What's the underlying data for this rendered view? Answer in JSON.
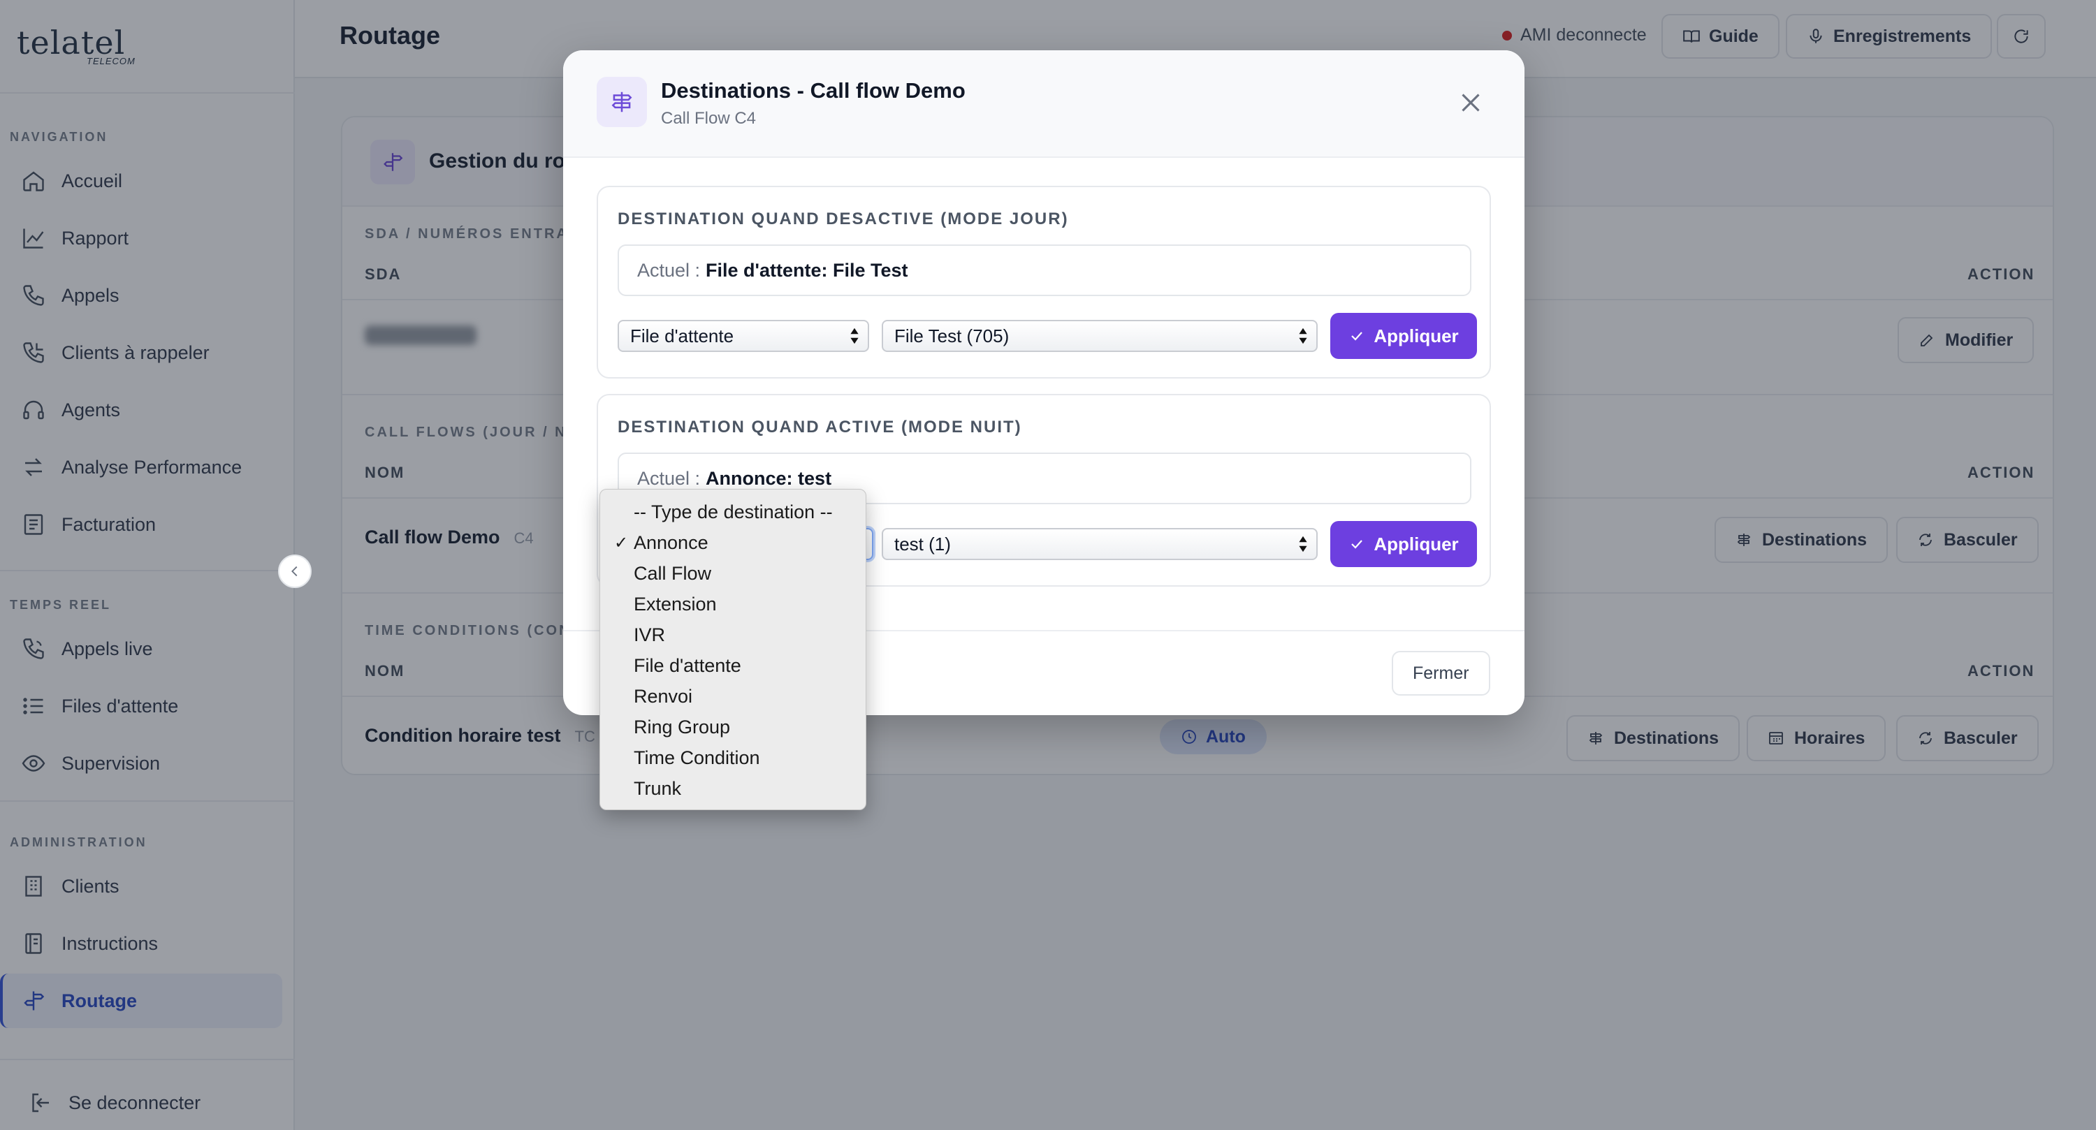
{
  "sidebar": {
    "logo_text": "telatel",
    "logo_sub": "TELECOM",
    "sections": {
      "navigation": "NAVIGATION",
      "realtime": "TEMPS REEL",
      "admin": "ADMINISTRATION"
    },
    "items": [
      {
        "label": "Accueil",
        "icon": "home-icon"
      },
      {
        "label": "Rapport",
        "icon": "chart-icon"
      },
      {
        "label": "Appels",
        "icon": "phone-icon"
      },
      {
        "label": "Clients à rappeler",
        "icon": "phone-callback-icon"
      },
      {
        "label": "Agents",
        "icon": "headset-icon"
      },
      {
        "label": "Analyse Performance",
        "icon": "arrows-icon"
      },
      {
        "label": "Facturation",
        "icon": "receipt-icon"
      },
      {
        "label": "Appels live",
        "icon": "phone-live-icon"
      },
      {
        "label": "Files d'attente",
        "icon": "list-icon"
      },
      {
        "label": "Supervision",
        "icon": "eye-icon"
      },
      {
        "label": "Clients",
        "icon": "building-icon"
      },
      {
        "label": "Instructions",
        "icon": "book-icon"
      },
      {
        "label": "Routage",
        "icon": "signpost-icon"
      }
    ],
    "logout": "Se deconnecter"
  },
  "topbar": {
    "title": "Routage",
    "ami_status": "AMI deconnecte",
    "guide": "Guide",
    "recordings": "Enregistrements"
  },
  "card": {
    "title": "Gestion du rou",
    "sda_section": "SDA / NUMÉROS ENTRAN",
    "sda_col": "SDA",
    "action_col": "ACTION",
    "modify": "Modifier",
    "cf_section": "CALL FLOWS (JOUR / NU",
    "name_col": "NOM",
    "cf_row_name": "Call flow Demo",
    "cf_row_code": "C4",
    "destinations": "Destinations",
    "toggle": "Basculer",
    "tc_section": "TIME CONDITIONS (CON",
    "tc_row_name": "Condition horaire test",
    "tc_row_code": "TC",
    "auto": "Auto",
    "schedules": "Horaires"
  },
  "modal": {
    "title": "Destinations - Call flow Demo",
    "subtitle": "Call Flow C4",
    "day": {
      "heading": "DESTINATION QUAND DESACTIVE (MODE JOUR)",
      "current_prefix": "Actuel :",
      "current_value": "File d'attente: File Test",
      "type_value": "File d'attente",
      "target_value": "File Test (705)",
      "apply": "Appliquer"
    },
    "night": {
      "heading": "DESTINATION QUAND ACTIVE (MODE NUIT)",
      "current_prefix": "Actuel :",
      "current_value": "Annonce: test",
      "target_value": "test (1)",
      "apply": "Appliquer"
    },
    "close": "Fermer"
  },
  "dropdown": {
    "placeholder": "-- Type de destination --",
    "selected": "Annonce",
    "options": [
      "Annonce",
      "Call Flow",
      "Extension",
      "IVR",
      "File d'attente",
      "Renvoi",
      "Ring Group",
      "Time Condition",
      "Trunk"
    ]
  },
  "colors": {
    "accent": "#6d3fe0",
    "active_nav": "#2f4fc4",
    "status_off": "#dc2626"
  }
}
